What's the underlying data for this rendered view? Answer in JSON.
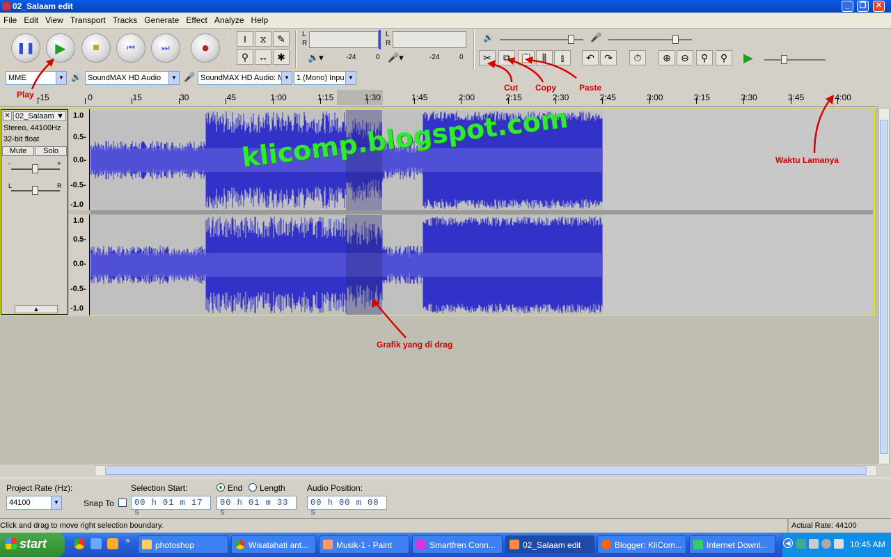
{
  "window": {
    "title": "02_Salaam edit",
    "min": "_",
    "max": "❐",
    "close": "✕"
  },
  "menu": [
    "File",
    "Edit",
    "View",
    "Transport",
    "Tracks",
    "Generate",
    "Effect",
    "Analyze",
    "Help"
  ],
  "meters": {
    "L": "L",
    "R": "R",
    "db_marks": [
      "-24",
      "0",
      "-24",
      "0"
    ]
  },
  "devices": {
    "host": "MME",
    "output": "SoundMAX HD Audio",
    "input": "SoundMAX HD Audio: M",
    "channels": "1 (Mono) Inpu"
  },
  "ruler": {
    "labels": [
      "-15",
      "0",
      "15",
      "30",
      "45",
      "1:00",
      "1:15",
      "1:30",
      "1:45",
      "2:00",
      "2:15",
      "2:30",
      "2:45",
      "3:00",
      "3:15",
      "3:30",
      "3:45",
      "4:00"
    ]
  },
  "track": {
    "name": "02_Salaam",
    "format": "Stereo, 44100Hz",
    "depth": "32-bit float",
    "mute": "Mute",
    "solo": "Solo",
    "pan_l": "L",
    "pan_r": "R",
    "gain_minus": "-",
    "gain_plus": "+"
  },
  "ylabels": [
    "1.0",
    "0.5-",
    "0.0-",
    "-0.5-",
    "-1.0"
  ],
  "annotations": {
    "play": "Play",
    "cut": "Cut",
    "copy": "Copy",
    "paste": "Paste",
    "duration": "Waktu Lamanya",
    "drag": "Grafik yang di drag"
  },
  "watermark": "klicomp.blogspot.com",
  "selection": {
    "project_rate_label": "Project Rate (Hz):",
    "project_rate": "44100",
    "snap_to": "Snap To",
    "selection_start_label": "Selection Start:",
    "end_label": "End",
    "length_label": "Length",
    "start_value": "00 h 01 m 17 s",
    "end_value": "00 h 01 m 33 s",
    "audio_position_label": "Audio Position:",
    "audio_position": "00 h 00 m 00 s"
  },
  "status": {
    "message": "Click and drag to move right selection boundary.",
    "rate": "Actual Rate: 44100"
  },
  "taskbar": {
    "start": "start",
    "tasks": [
      "photoshop",
      "Wisatahati ant...",
      "Musik-1 - Paint",
      "Smartfren Conn...",
      "02_Salaam edit",
      "Blogger: KliCom...",
      "Internet Downl..."
    ],
    "clock": "10:45 AM"
  },
  "colors": {
    "waveform": "#3232c8",
    "annotation": "#d40000",
    "watermark": "#33e833"
  }
}
